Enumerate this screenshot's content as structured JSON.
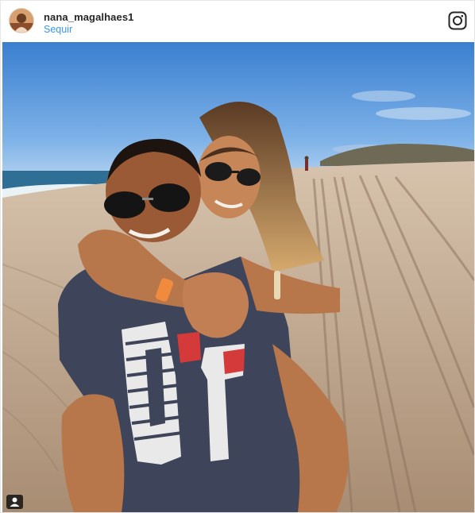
{
  "post": {
    "username": "nana_magalhaes1",
    "follow_label": "Sequir"
  },
  "icons": {
    "brand": "instagram-icon",
    "user_tag": "user-tag-icon"
  },
  "colors": {
    "follow_link": "#3897f0",
    "username_text": "#262626"
  }
}
